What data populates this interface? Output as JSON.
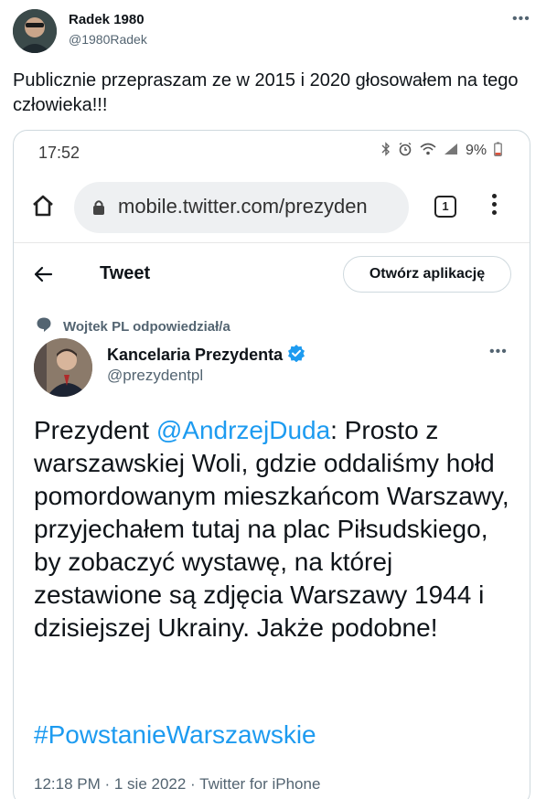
{
  "outer_tweet": {
    "author_name": "Radek 1980",
    "author_handle": "@1980Radek",
    "more_glyph": "•••",
    "text": "Publicznie przepraszam ze w 2015 i 2020 głosowałem na tego człowieka!!!"
  },
  "phone": {
    "time": "17:52",
    "battery": "9%",
    "url": "mobile.twitter.com/prezyden",
    "tab_count": "1"
  },
  "twitter_page": {
    "title": "Tweet",
    "open_app_label": "Otwórz aplikację",
    "reply_context": "Wojtek PL odpowiedział/a",
    "author_name": "Kancelaria Prezydenta",
    "author_handle": "@prezydentpl",
    "more_glyph": "•••",
    "body_prefix": "Prezydent ",
    "body_mention": "@AndrzejDuda",
    "body_rest": ": Prosto z warszawskiej Woli, gdzie oddaliśmy hołd pomordowanym mieszkańcom Warszawy, przyjechałem tutaj na plac Piłsudskiego, by zobaczyć wystawę, na której zestawione są zdjęcia Warszawy 1944 i dzisiejszej Ukrainy. Jakże podobne!",
    "hashtag": "#PowstanieWarszawskie",
    "meta": "12:18 PM · 1 sie 2022 · Twitter for iPhone"
  },
  "colors": {
    "link": "#1d9bf0",
    "secondary_text": "#536471",
    "verified": "#1d9bf0"
  }
}
